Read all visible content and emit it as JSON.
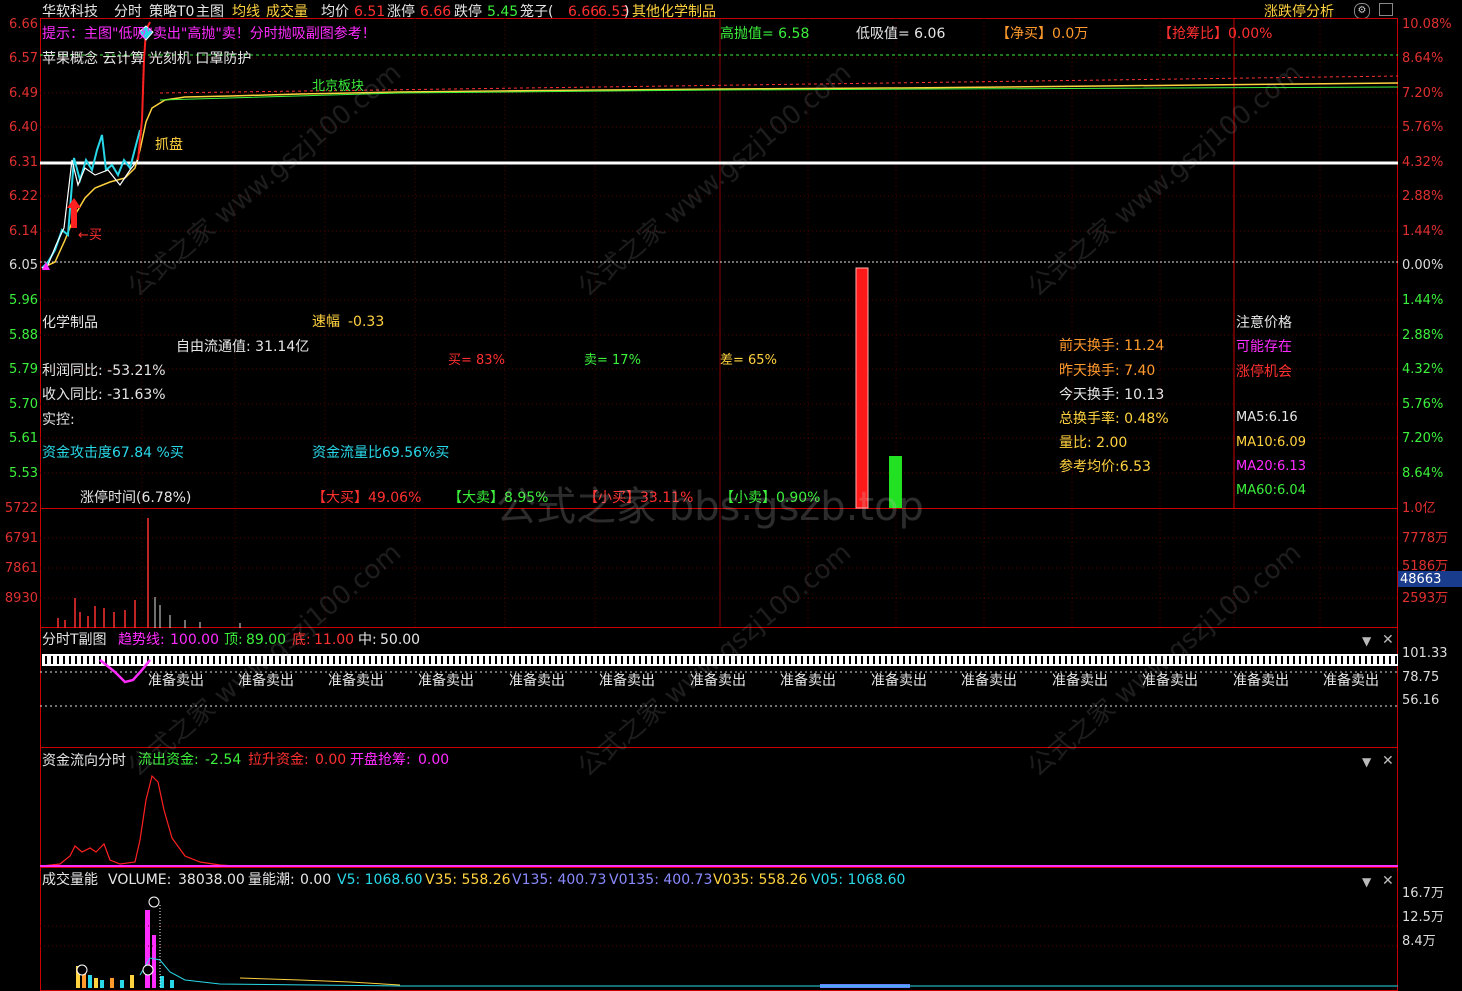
{
  "header": {
    "stock_name": "华软科技",
    "tab_fenshi": "分时",
    "tab_celue": "策略T0",
    "tab_zhutu": "主图",
    "ind_junxian": "均线",
    "ind_chengjiao": "成交量",
    "avg_label": "均价",
    "avg_value": "6.51",
    "up_label": "涨停",
    "up_value": "6.66",
    "down_label": "跌停",
    "down_value": "5.45",
    "cage_label": "笼子(",
    "cage_v1": "6.66",
    "cage_v2": "6.53",
    "cage_close": ")",
    "sector": "其他化学制品",
    "right_title": "涨跌停分析"
  },
  "main_chart": {
    "hint": "提示：主图\"低吸\"卖出\"高抛\"卖！分时抛吸副图参考！",
    "concepts": "苹果概念 云计算 光刻机 口罩防护",
    "high_sell": "高抛值= 6.58",
    "low_buy": "低吸值= 6.06",
    "net_buy": "【净买】0.0万",
    "grab_ratio": "【抢筹比】0.00%",
    "beijing_label": "北京板块",
    "zhuapan_label": "抓盘",
    "buy_mark": "←买",
    "price_labels": [
      "6.66",
      "6.57",
      "6.49",
      "6.40",
      "6.31",
      "6.22",
      "6.14",
      "6.05",
      "5.96",
      "5.88",
      "5.79",
      "5.70",
      "5.61",
      "5.53"
    ],
    "pct_labels": [
      "10.08%",
      "8.64%",
      "7.20%",
      "5.76%",
      "4.32%",
      "2.88%",
      "1.44%",
      "0.00%",
      "1.44%",
      "2.88%",
      "4.32%",
      "5.76%",
      "7.20%",
      "8.64%"
    ],
    "info": {
      "industry": "化学制品",
      "speed_label": "速幅",
      "speed_value": "-0.33",
      "float_cap": "自由流通值: 31.14亿",
      "buy_pct": "买= 83%",
      "sell_pct": "卖= 17%",
      "diff_pct": "差= 65%",
      "profit_yoy": "利润同比: -53.21%",
      "revenue_yoy": "收入同比: -31.63%",
      "controller": "实控:",
      "attack": "资金攻击度67.84 %买",
      "flow": "资金流量比69.56%买",
      "prev2_turn": "前天换手: 11.24",
      "prev_turn": "昨天换手: 7.40",
      "today_turn": "今天换手: 10.13",
      "total_turn": "总换手率: 0.48%",
      "vol_ratio": "量比: 2.00",
      "ref_avg": "参考均价:6.53",
      "attention": "注意价格",
      "maybe": "可能存在",
      "limit_chance": "涨停机会",
      "ma5": "MA5:6.16",
      "ma10": "MA10:6.09",
      "ma20": "MA20:6.13",
      "ma60": "MA60:6.04",
      "limit_time": "涨停时间",
      "limit_time_val": "(6.78%)",
      "big_buy": "【大买】49.06%",
      "big_sell": "【大卖】8.95%",
      "small_buy": "【小买】33.11%",
      "small_sell": "【小卖】0.90%"
    },
    "bars": [
      {
        "name": "red-bar",
        "value": 83,
        "color": "#ff1a1a"
      },
      {
        "name": "green-bar",
        "value": 17,
        "color": "#22e022"
      }
    ]
  },
  "volume_panel": {
    "left_labels": [
      "5722",
      "6791",
      "7861",
      "8930"
    ],
    "right_labels": [
      "1.0亿",
      "7778万",
      "5186万",
      "2593万"
    ],
    "cursor_value": "48663"
  },
  "ft_panel": {
    "title": "分时T副图",
    "trend_label": "趋势线:",
    "trend_value": "100.00",
    "top_label": "顶:",
    "top_value": "89.00",
    "bottom_label": "底:",
    "bottom_value": "11.00",
    "mid_label": "中:",
    "mid_value": "50.00",
    "right_labels": [
      "101.33",
      "78.75",
      "56.16"
    ],
    "sell_label": "准备卖出"
  },
  "flow_panel": {
    "title": "资金流向分时",
    "out_label": "流出资金:",
    "out_value": "-2.54",
    "pull_label": "拉升资金:",
    "pull_value": "0.00",
    "open_label": "开盘抢筹:",
    "open_value": "0.00"
  },
  "vol_energy_panel": {
    "title": "成交量能",
    "volume_label": "VOLUME:",
    "volume_value": "38038.00",
    "tide_label": "量能潮:",
    "tide_value": "0.00",
    "v5": "V5: 1068.60",
    "v35": "V35: 558.26",
    "v135": "V135: 400.73",
    "v0135": "V0135: 400.73",
    "v035": "V035: 558.26",
    "v05": "V05: 1068.60",
    "right_labels": [
      "16.7万",
      "12.5万",
      "8.4万"
    ]
  },
  "watermark": "公式之家 bbs.gszb.top",
  "watermark_diag": "公式之家 www.gszj100.com",
  "colors": {
    "red": "#cc0000",
    "yellow": "#ffd23f",
    "green": "#3cf03c",
    "cyan": "#29d8e8",
    "magenta": "#ff2cff"
  },
  "icons": [
    "gear-icon",
    "window-icon",
    "close-icon",
    "chevron-down-icon"
  ]
}
